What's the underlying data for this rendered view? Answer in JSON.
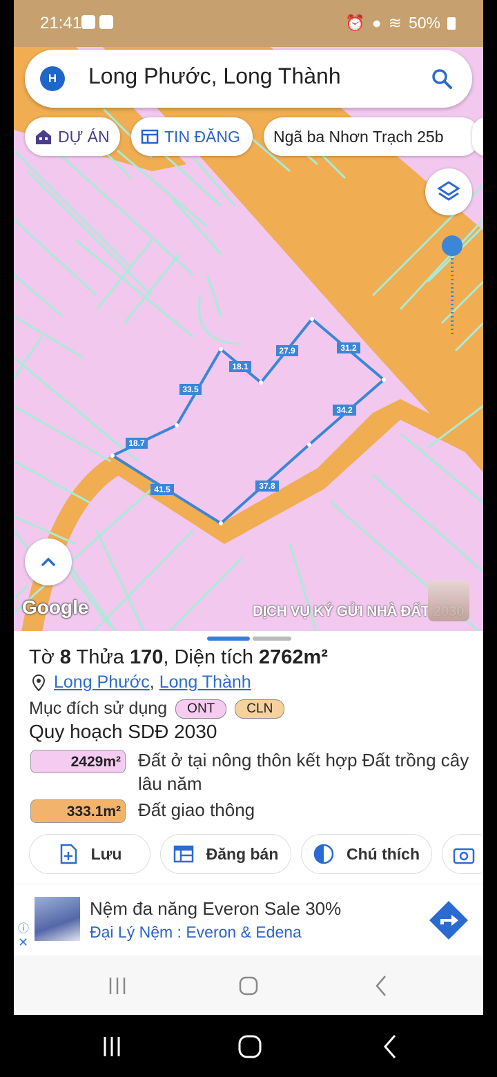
{
  "status_bar": {
    "time": "21:41",
    "battery": "50%"
  },
  "search": {
    "avatar_letter": "H",
    "query": "Long Phước, Long Thành"
  },
  "chips": [
    {
      "label": "DỰ ÁN"
    },
    {
      "label": "TIN ĐĂNG"
    },
    {
      "label": "Ngã ba Nhơn Trạch 25b"
    }
  ],
  "map": {
    "edge_lengths": [
      "27.9",
      "31.2",
      "18.1",
      "33.5",
      "34.2",
      "18.7",
      "41.5",
      "37.8"
    ],
    "logo": "Google",
    "watermark": "DỊCH VỤ KÝ GỬI NHÀ ĐẤT 2030",
    "colors": {
      "residential": "#f2c8ef",
      "road": "#f0ad52",
      "parcel_line": "#a8ecd8",
      "boundary": "#3b86d6"
    }
  },
  "parcel": {
    "title_prefix": "Tờ",
    "sheet": "8",
    "lot_label": "Thửa",
    "lot": "170",
    "area_label": ", Diện tích",
    "area": "2762m²",
    "ward": "Long Phước",
    "district": "Long Thành",
    "separator": ", ",
    "purpose_label": "Mục đích sử dụng",
    "purpose_codes": [
      "ONT",
      "CLN"
    ],
    "plan_title": "Quy hoạch SDĐ 2030",
    "zones": [
      {
        "area": "2429m²",
        "description": "Đất ở tại nông thôn kết hợp Đất trồng cây lâu năm",
        "color": "#f6cbf1"
      },
      {
        "area": "333.1m²",
        "description": "Đất giao thông",
        "color": "#f2b46c"
      }
    ]
  },
  "actions": {
    "save": "Lưu",
    "post": "Đăng bán",
    "legend": "Chú thích"
  },
  "ad": {
    "title": "Nệm đa năng Everon Sale 30%",
    "subtitle": "Đại Lý Nệm : Everon & Edena"
  }
}
